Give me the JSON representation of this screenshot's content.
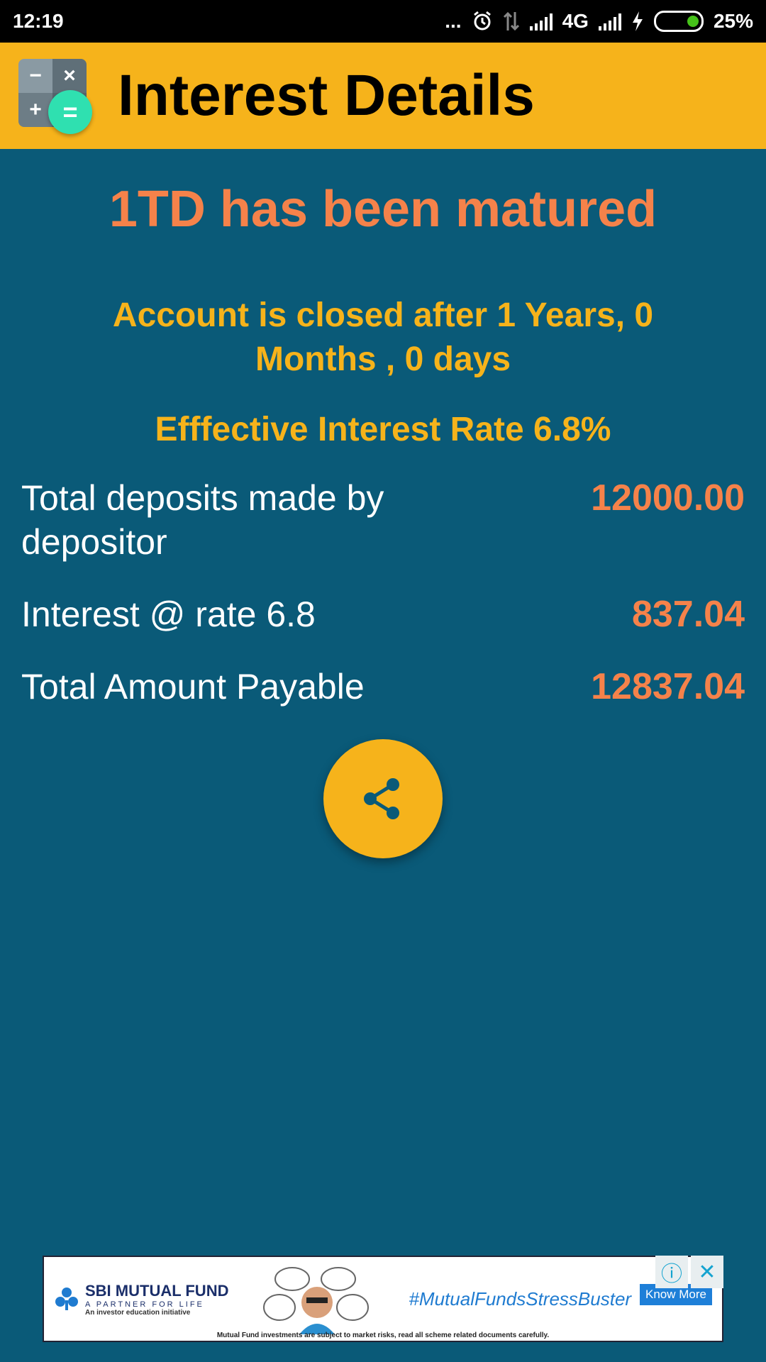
{
  "status_bar": {
    "time": "12:19",
    "dots": "...",
    "network": "4G",
    "battery": "25%"
  },
  "app_bar": {
    "title": "Interest Details",
    "icon_minus": "−",
    "icon_times": "×",
    "icon_plus": "+",
    "icon_equals": "="
  },
  "main": {
    "matured_heading": "1TD has been matured",
    "closed_text": "Account is closed after 1 Years, 0 Months , 0 days",
    "rate_text": "Efffective Interest Rate 6.8%",
    "rows": [
      {
        "label": "Total deposits made by depositor",
        "value": "12000.00"
      },
      {
        "label": "Interest @ rate 6.8",
        "value": "837.04"
      },
      {
        "label": "Total Amount Payable",
        "value": "12837.04"
      }
    ]
  },
  "ad": {
    "brand": "SBI MUTUAL FUND",
    "tagline": "A PARTNER FOR LIFE",
    "subline": "An investor education initiative",
    "hashtag": "#MutualFundsStressBuster",
    "cta": "Know More",
    "disclaimer": "Mutual Fund investments are subject to market risks, read all scheme related documents carefully.",
    "info_icon": "ⓘ",
    "close_icon": "✕"
  },
  "colors": {
    "background": "#0a5a78",
    "app_bar": "#f6b31b",
    "accent_orange": "#f5824a",
    "accent_yellow": "#f6b31b"
  }
}
